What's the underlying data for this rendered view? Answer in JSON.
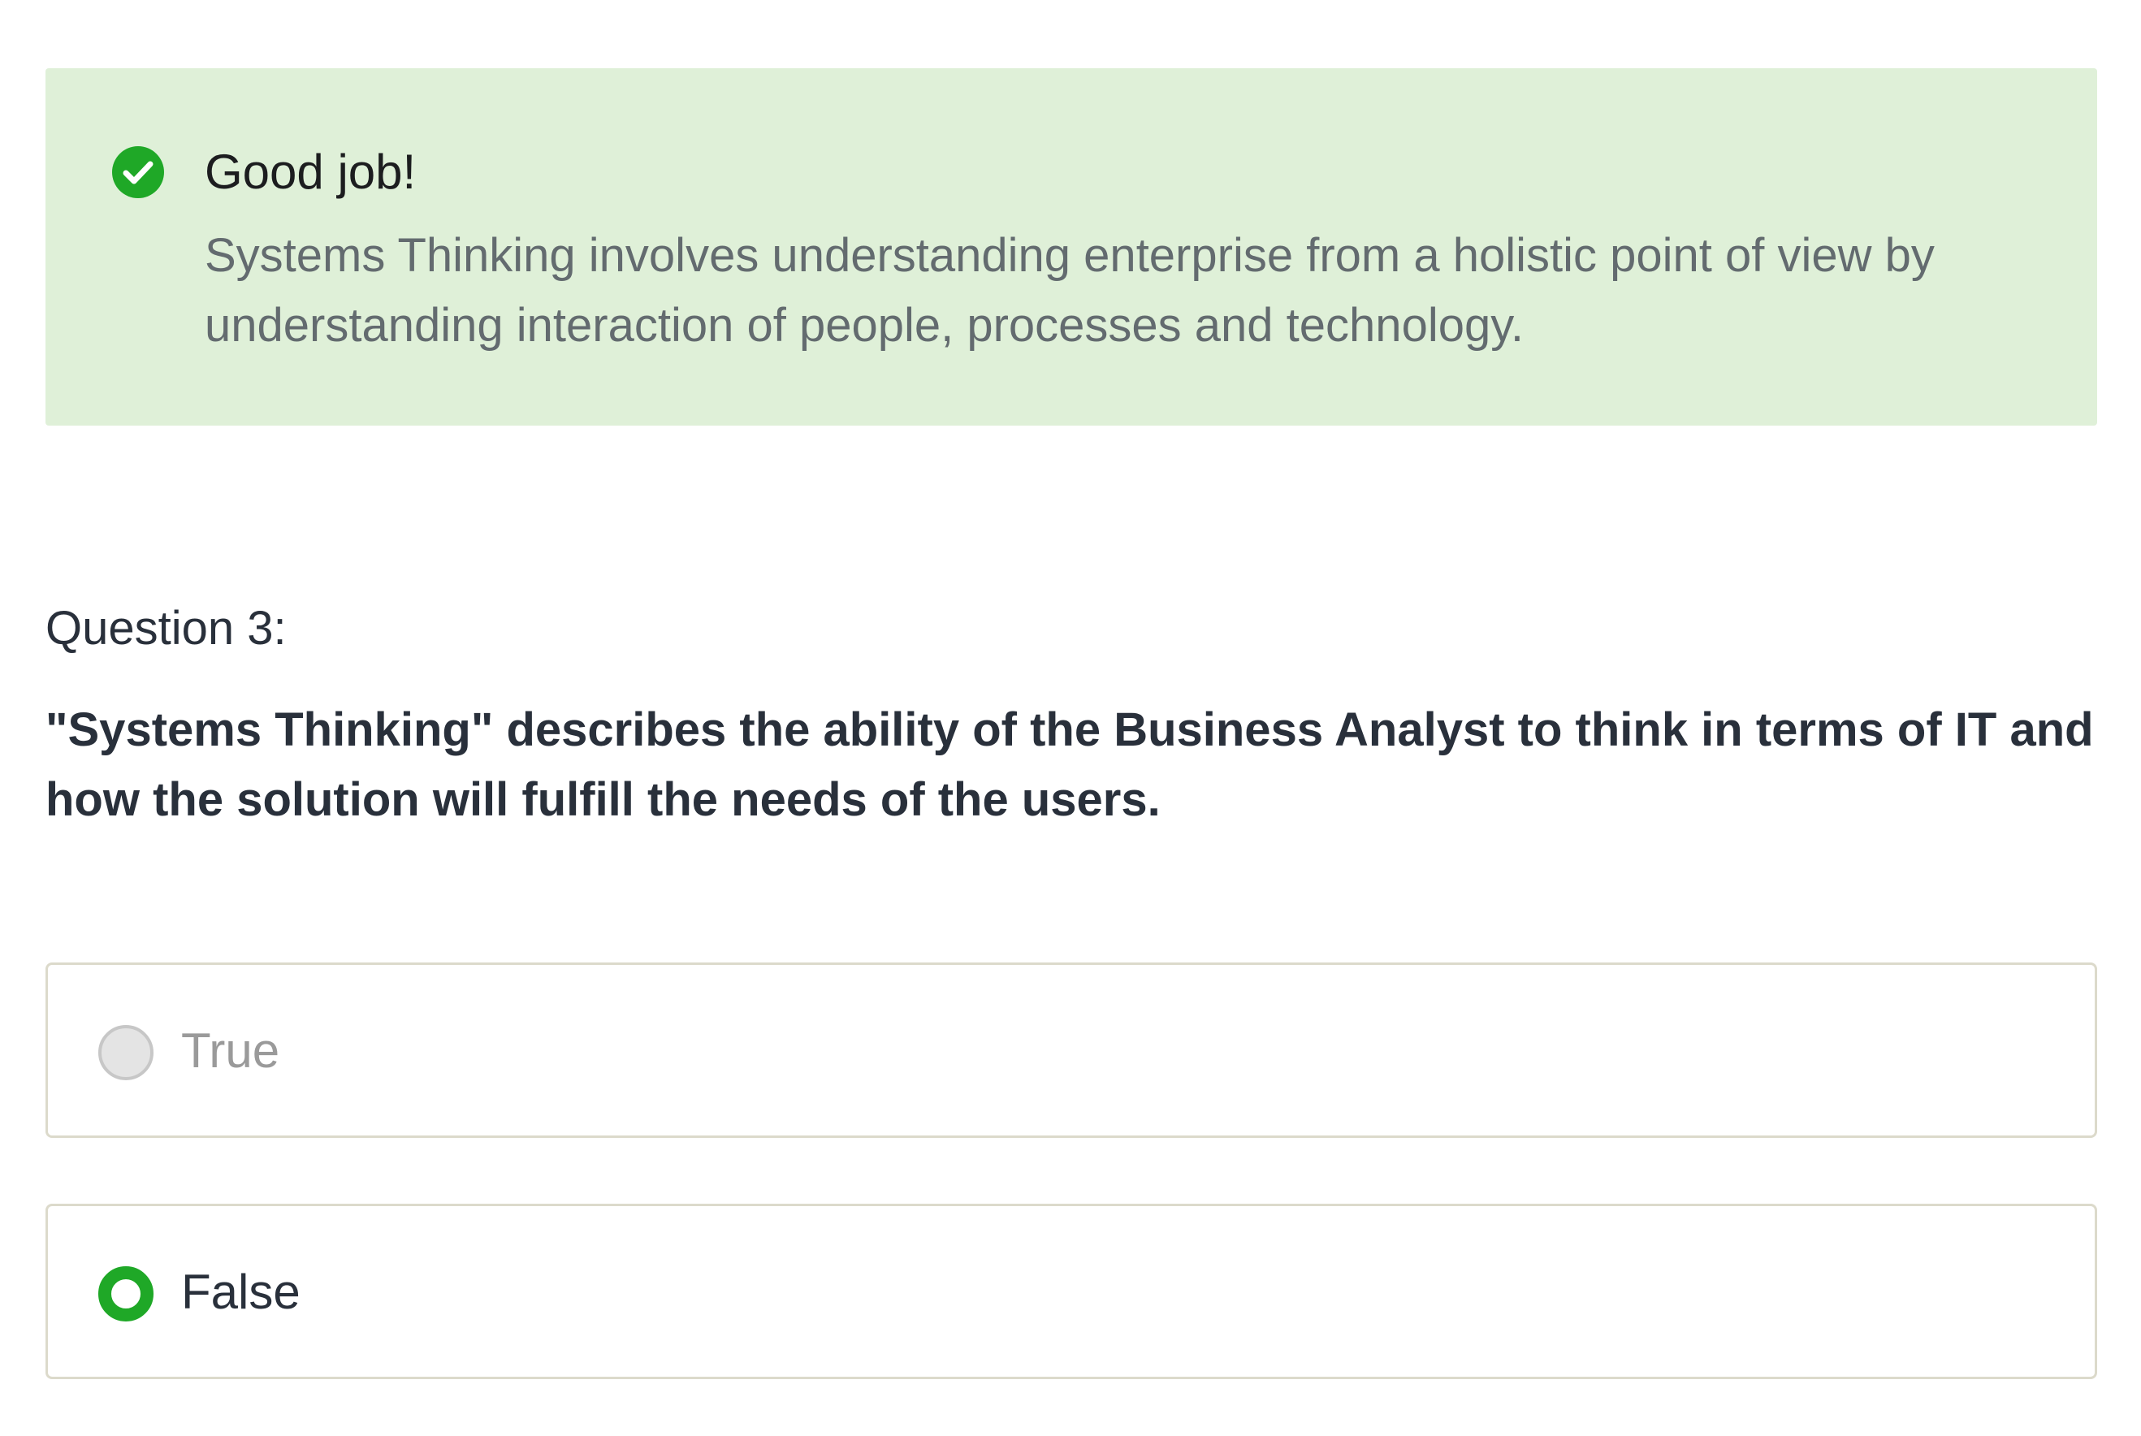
{
  "feedback": {
    "icon": "check-circle-icon",
    "icon_color": "#1fa827",
    "background_color": "#dff0d8",
    "title": "Good job!",
    "body": "Systems Thinking involves understanding enterprise from a holistic point of view by understanding interaction of people, processes and technology."
  },
  "question": {
    "label": "Question 3:",
    "text": "\"Systems Thinking\" describes the ability of the Business Analyst to think in terms of IT and how the solution will fulfill the needs of the users."
  },
  "options": [
    {
      "label": "True",
      "selected": false
    },
    {
      "label": "False",
      "selected": true
    }
  ],
  "accent_color": "#1fa827"
}
